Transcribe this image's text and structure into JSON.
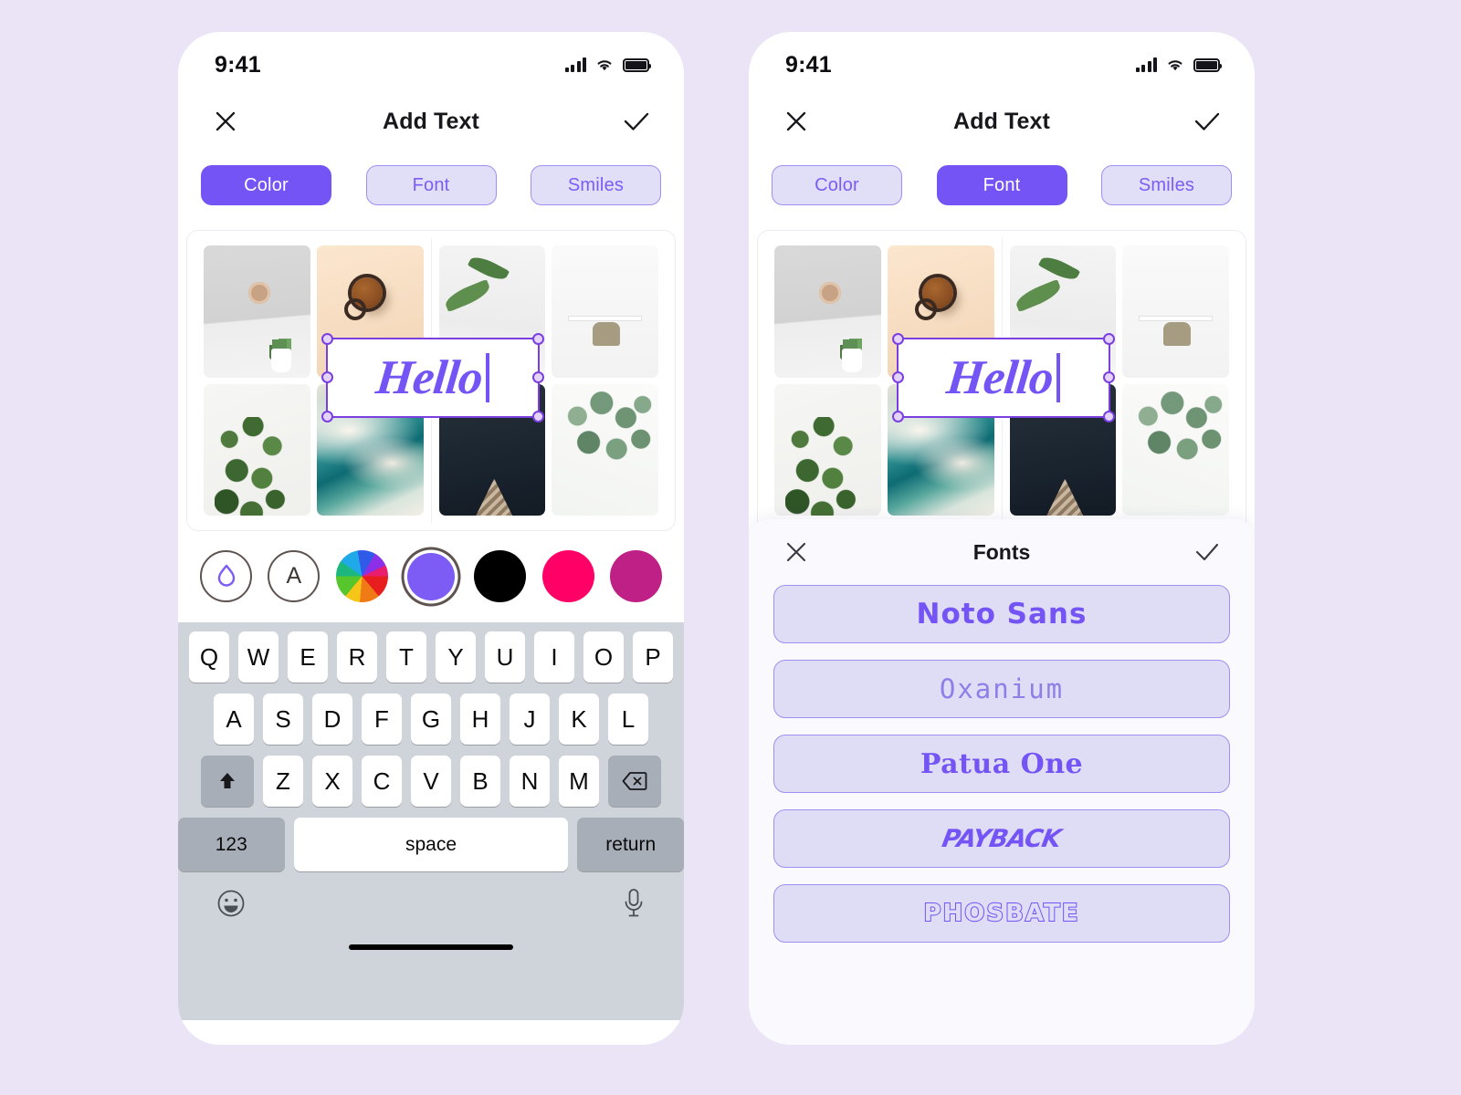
{
  "background_color": "#EAE4F6",
  "accent_color": "#7454F4",
  "status_bar": {
    "time": "9:41",
    "cellular_icon": "cellular-bars-icon",
    "wifi_icon": "wifi-icon",
    "battery_icon": "battery-icon"
  },
  "nav": {
    "close_icon": "close-x-icon",
    "title": "Add Text",
    "confirm_icon": "checkmark-icon"
  },
  "tabs": [
    {
      "label": "Color",
      "active_left": true,
      "active_right": false
    },
    {
      "label": "Font",
      "active_left": false,
      "active_right": true
    },
    {
      "label": "Smiles",
      "active_left": false,
      "active_right": false
    }
  ],
  "canvas": {
    "text_value": "Hello",
    "caret_visible": true,
    "selection_handles": 6,
    "selection_color": "#7B3FE0",
    "text_color": "#7454F4",
    "photos": [
      {
        "name": "wall-clock-with-plant"
      },
      {
        "name": "coffee-cup-on-peach"
      },
      {
        "name": "green-leaf-on-white"
      },
      {
        "name": "desk-with-chair"
      },
      {
        "name": "eucalyptus-branch-dark"
      },
      {
        "name": "teal-marble-texture"
      },
      {
        "name": "dark-navy-frame"
      },
      {
        "name": "pale-eucalyptus"
      }
    ]
  },
  "color_palette": {
    "swatches": [
      {
        "name": "opacity-droplet",
        "type": "icon",
        "color": "#7C5CF5",
        "selected": false
      },
      {
        "name": "text-style-a",
        "type": "icon",
        "label": "A",
        "color": "#3F3936",
        "selected": false
      },
      {
        "name": "color-wheel",
        "type": "wheel",
        "selected": false
      },
      {
        "name": "purple",
        "type": "solid",
        "color": "#7C5CF5",
        "selected": true
      },
      {
        "name": "black",
        "type": "solid",
        "color": "#000000",
        "selected": false
      },
      {
        "name": "pink",
        "type": "solid",
        "color": "#FF0066",
        "selected": false
      },
      {
        "name": "magenta",
        "type": "solid",
        "color": "#BE2086",
        "selected": false
      }
    ]
  },
  "keyboard": {
    "row1": [
      "Q",
      "W",
      "E",
      "R",
      "T",
      "Y",
      "U",
      "I",
      "O",
      "P"
    ],
    "row2": [
      "A",
      "S",
      "D",
      "F",
      "G",
      "H",
      "J",
      "K",
      "L"
    ],
    "row3": [
      "Z",
      "X",
      "C",
      "V",
      "B",
      "N",
      "M"
    ],
    "shift_icon": "shift-arrow-icon",
    "backspace_icon": "backspace-icon",
    "numbers_label": "123",
    "space_label": "space",
    "return_label": "return",
    "emoji_icon": "emoji-smiley-icon",
    "mic_icon": "microphone-icon"
  },
  "fonts_sheet": {
    "close_icon": "close-x-icon",
    "title": "Fonts",
    "confirm_icon": "checkmark-icon",
    "items": [
      {
        "label": "Noto Sans",
        "style": "noto"
      },
      {
        "label": "Oxanium",
        "style": "oxanium"
      },
      {
        "label": "Patua One",
        "style": "patua"
      },
      {
        "label": "PAYBACK",
        "style": "payback"
      },
      {
        "label": "PHOSBATE",
        "style": "phosbate"
      }
    ]
  }
}
